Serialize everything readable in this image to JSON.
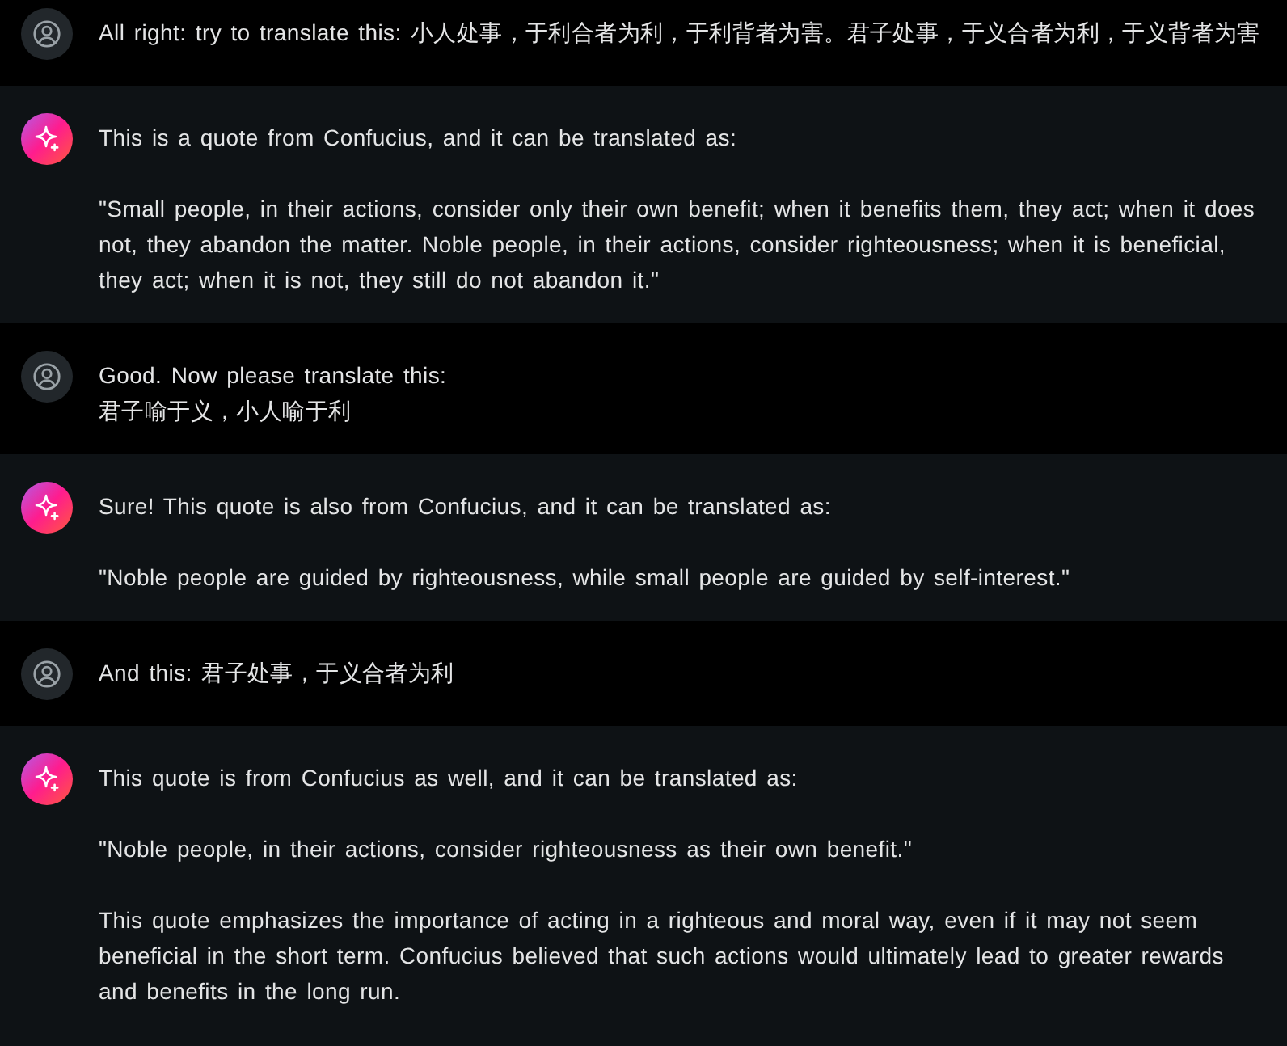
{
  "messages": [
    {
      "kind": "user",
      "paragraphs": [
        "All right: try to translate this: 小人处事，于利合者为利，于利背者为害。君子处事，于义合者为利，于义背者为害"
      ]
    },
    {
      "kind": "assistant",
      "paragraphs": [
        "This is a quote from Confucius, and it can be translated as:",
        "\"Small people, in their actions, consider only their own benefit; when it benefits them, they act; when it does not, they abandon the matter. Noble people, in their actions, consider righteousness; when it is beneficial, they act; when it is not, they still do not abandon it.\""
      ]
    },
    {
      "kind": "user",
      "paragraphs": [
        "Good. Now please translate this:\n君子喻于义，小人喻于利"
      ]
    },
    {
      "kind": "assistant",
      "paragraphs": [
        "Sure! This quote is also from Confucius, and it can be translated as:",
        "\"Noble people are guided by righteousness, while small people are guided by self-interest.\""
      ]
    },
    {
      "kind": "user",
      "paragraphs": [
        "And this: 君子处事，于义合者为利"
      ]
    },
    {
      "kind": "assistant",
      "paragraphs": [
        "This quote is from Confucius as well, and it can be translated as:",
        "\"Noble people, in their actions, consider righteousness as their own benefit.\"",
        "This quote emphasizes the importance of acting in a righteous and moral way, even if it may not seem beneficial in the short term. Confucius believed that such actions would ultimately lead to greater rewards and benefits in the long run."
      ]
    }
  ]
}
